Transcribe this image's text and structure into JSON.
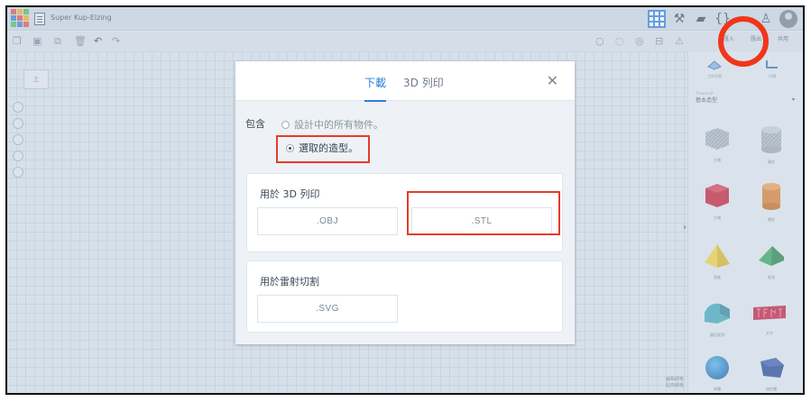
{
  "app": {
    "title": "Super Kup-Elzing"
  },
  "colors": {
    "accent": "#2e7fd8",
    "annotation": "#e53b2a",
    "logo": [
      "#e8483b",
      "#f5a623",
      "#4fb74f",
      "#2e7fd8",
      "#e8483b",
      "#f5a623",
      "#4fb74f",
      "#2e7fd8",
      "#e8483b"
    ]
  },
  "toolbar": {
    "icons": [
      "copy-icon",
      "paste-icon",
      "duplicate-icon",
      "delete-icon",
      "undo-icon",
      "redo-icon"
    ],
    "right_tabs": [
      "匯入",
      "匯出",
      "共用"
    ]
  },
  "workplane": {
    "viewcube_label": "上",
    "grid_caption_1": "編輯網格",
    "grid_caption_2": "貼齊網格"
  },
  "panel": {
    "top_items": [
      "工作平面",
      "尺規"
    ],
    "category_small": "Tinkercad",
    "category": "基本造型",
    "shapes": [
      {
        "label": "方塊",
        "icon": "box-icon"
      },
      {
        "label": "圓柱",
        "icon": "cylinder-icon"
      },
      {
        "label": "方塊",
        "icon": "box-solid-icon"
      },
      {
        "label": "圓柱",
        "icon": "cylinder-solid-icon"
      },
      {
        "label": "角錐",
        "icon": "pyramid-icon"
      },
      {
        "label": "屋頂",
        "icon": "roof-icon"
      },
      {
        "label": "圓形屋頂",
        "icon": "round-roof-icon"
      },
      {
        "label": "文字",
        "icon": "text-icon"
      },
      {
        "label": "球體",
        "icon": "sphere-icon"
      },
      {
        "label": "稜柱體",
        "icon": "prism-icon"
      }
    ]
  },
  "modal": {
    "tab_download": "下載",
    "tab_print": "3D 列印",
    "include_label": "包含",
    "option_all": "設計中的所有物件。",
    "option_selected": "選取的造型。",
    "section_print": "用於 3D 列印",
    "btn_obj": ".OBJ",
    "btn_stl": ".STL",
    "section_laser": "用於雷射切割",
    "btn_svg": ".SVG"
  }
}
